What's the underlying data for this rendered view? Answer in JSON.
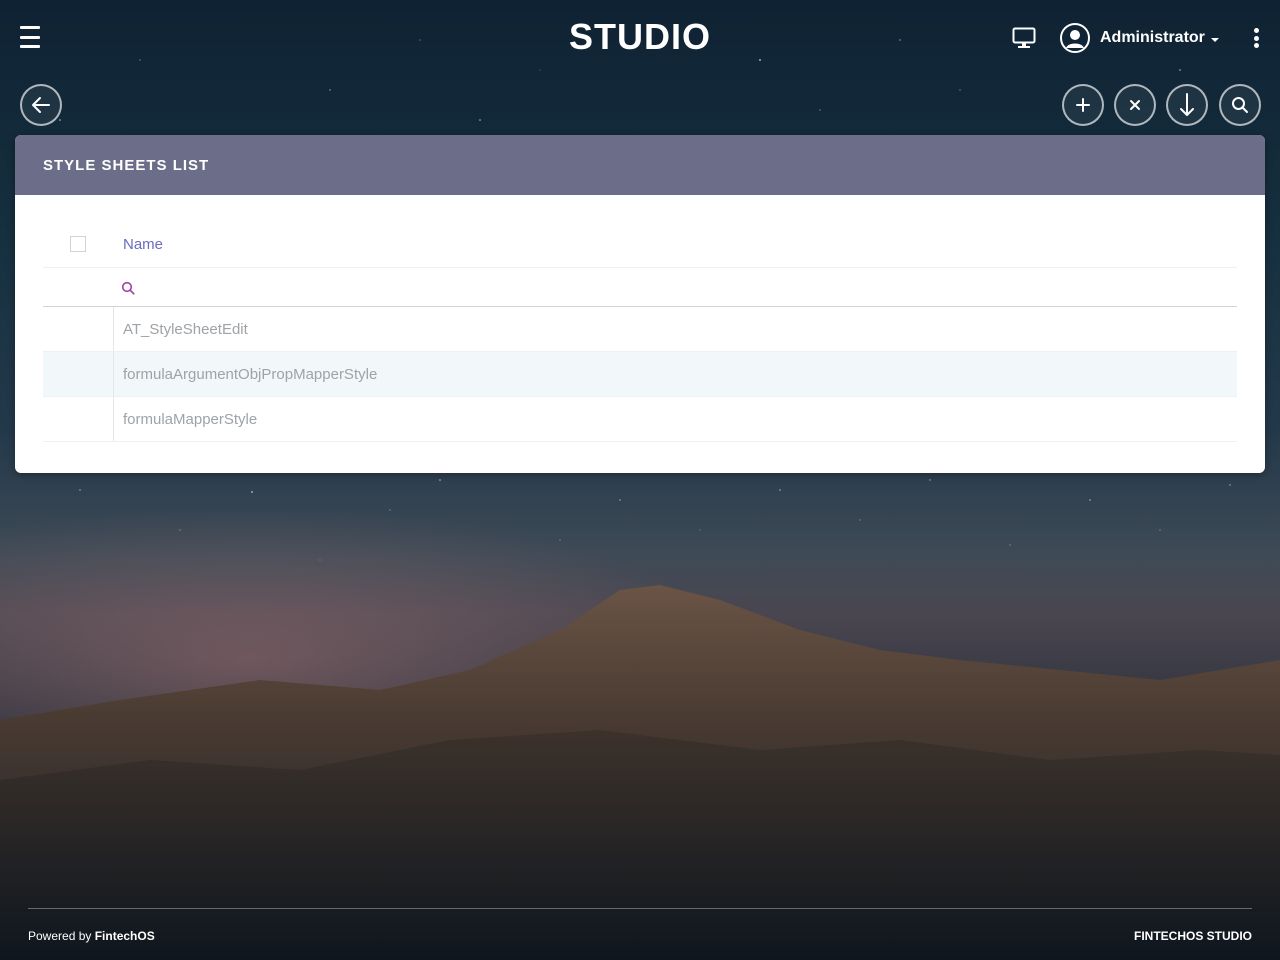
{
  "header": {
    "logo_text": "STUDIO",
    "user_name": "Administrator",
    "menu_icon": "hamburger-menu-icon",
    "monitor_icon": "monitor-icon",
    "avatar_icon": "user-avatar-icon",
    "more_icon": "kebab-menu-icon"
  },
  "toolbar": {
    "back_icon": "arrow-left-icon",
    "actions": [
      "plus-icon",
      "close-icon",
      "arrow-down-icon",
      "search-icon"
    ]
  },
  "panel": {
    "title": "STYLE SHEETS LIST",
    "columns": [
      "Name"
    ],
    "filter": {
      "value": "",
      "icon": "search-icon"
    },
    "rows": [
      {
        "name": "AT_StyleSheetEdit"
      },
      {
        "name": "formulaArgumentObjPropMapperStyle"
      },
      {
        "name": "formulaMapperStyle"
      }
    ]
  },
  "footer": {
    "powered_prefix": "Powered by ",
    "powered_brand": "FintechOS",
    "right_text": "FINTECHOS STUDIO"
  },
  "colors": {
    "panel_header": "#6b6d89",
    "column_header_text": "#6a6cc0",
    "filter_icon": "#a23fa7",
    "row_text": "#9ea3a8"
  }
}
